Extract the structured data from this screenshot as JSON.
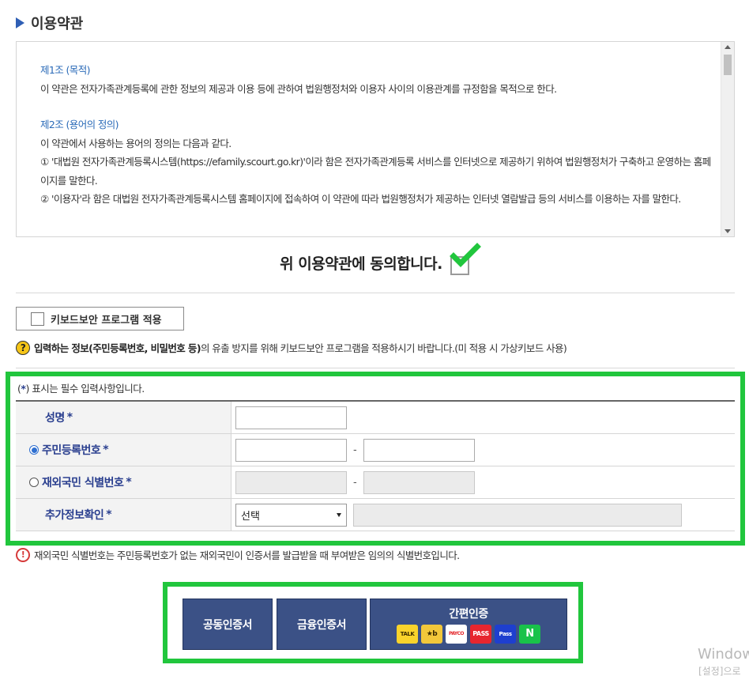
{
  "section": {
    "title": "이용약관"
  },
  "terms": {
    "art1_title": "제1조 (목적)",
    "art1_body": "이 약관은 전자가족관계등록에 관한 정보의 제공과 이용 등에 관하여 법원행정처와 이용자 사이의 이용관계를 규정함을 목적으로 한다.",
    "art2_title": "제2조 (용어의 정의)",
    "art2_intro": "이 약관에서 사용하는 용어의 정의는 다음과 같다.",
    "art2_item1": "① '대법원 전자가족관계등록시스템(https://efamily.scourt.go.kr)'이라 함은 전자가족관계등록 서비스를 인터넷으로 제공하기 위하여 법원행정처가 구축하고 운영하는 홈페이지를 말한다.",
    "art2_item2": "② '이용자'라 함은 대법원 전자가족관계등록시스템 홈페이지에 접속하여 이 약관에 따라 법원행정처가 제공하는 인터넷 열람발급 등의 서비스를 이용하는 자를 말한다."
  },
  "agree": {
    "label": "위 이용약관에 동의합니다.",
    "checked": true
  },
  "keyboard": {
    "button_label": "키보드보안 프로그램 적용",
    "note_icon": "?",
    "note_bold": "입력하는 정보(주민등록번호, 비밀번호 등)",
    "note_rest": "의 유출 방지를 위해 키보드보안 프로그램을 적용하시기 바랍니다.(미 적용 시 가상키보드 사용)"
  },
  "form": {
    "required_note_open": "(",
    "required_note_star": "*",
    "required_note_rest": ") 표시는 필수 입력사항입니다.",
    "star": "*",
    "name_label": "성명",
    "rrn_label": "주민등록번호",
    "foreign_label": "재외국민 식별번호",
    "extra_label": "추가정보확인",
    "dash": "-",
    "extra_select_value": "선택",
    "rrn_selected": true
  },
  "warning": {
    "icon": "!",
    "text": "재외국민 식별번호는 주민등록번호가 없는 재외국민이 인증서를 발급받을 때 부여받은 임의의 식별번호입니다."
  },
  "auth": {
    "joint_cert": "공동인증서",
    "finance_cert": "금융인증서",
    "simple_auth": "간편인증",
    "logos": {
      "talk": "TALK",
      "kb": "★b",
      "payco": "PAYCO",
      "pass": "PASS",
      "samsung_pass": "Pass",
      "naver": "N"
    }
  },
  "watermark": {
    "line1": "Window",
    "line2": "[설정]으로"
  },
  "colors": {
    "accent": "#2f5fb5",
    "highlight_green": "#21c63d",
    "button_navy": "#3b5186"
  }
}
